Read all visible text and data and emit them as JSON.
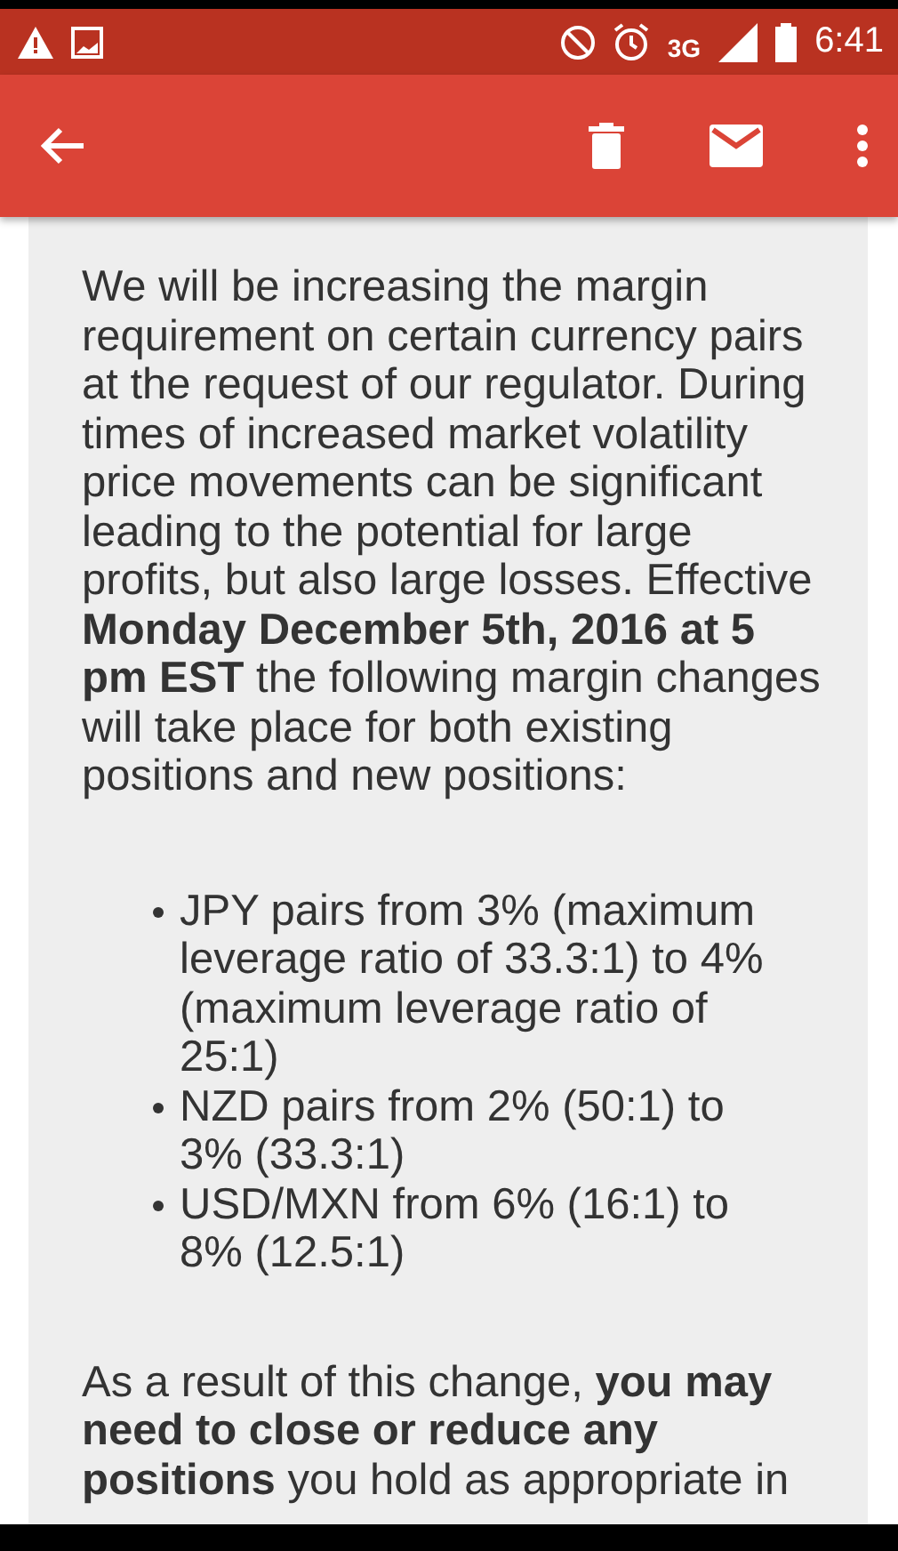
{
  "status_bar": {
    "network": "3G",
    "time": "6:41"
  },
  "toolbar": {
    "actions": [
      {
        "kind": "back"
      },
      {
        "kind": "delete"
      },
      {
        "kind": "mail"
      },
      {
        "kind": "more"
      }
    ]
  },
  "message": {
    "intro": "We will be increasing the margin requirement on certain currency pairs at the request of our regulator. During times of increased market volatility price movements can be significant leading to the potential for large profits, but also large losses. Effective **Monday December 5th, 2016 at 5 pm EST** the following margin changes will take place for both existing positions and new positions:",
    "bullets": [
      "JPY pairs from 3% (maximum leverage ratio of 33.3:1) to 4% (maximum leverage ratio of 25:1)",
      "NZD pairs from 2% (50:1) to 3% (33.3:1)",
      "USD/MXN from 6% (16:1) to 8% (12.5:1)"
    ],
    "closing": "As a result of this change, **you may need to close or reduce any positions** you hold as appropriate in"
  }
}
